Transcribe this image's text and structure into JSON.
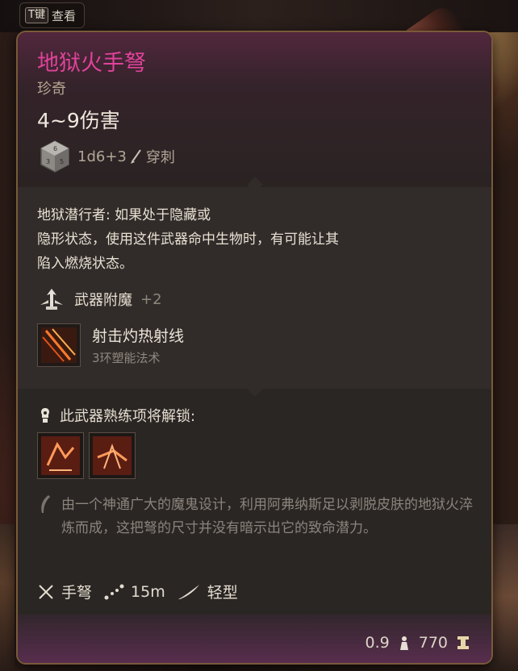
{
  "hint": {
    "key": "T键",
    "label": "查看"
  },
  "item": {
    "name": "地狱火手弩",
    "rarity": "珍奇",
    "damage": "4~9伤害",
    "dice": "1d6+3",
    "damage_type": "穿刺"
  },
  "passive": {
    "title": "地狱潜行者:",
    "line1_rest": " 如果处于隐藏或",
    "line2": "隐形状态，使用这件武器命中生物时，有可能让其",
    "line3": "陷入燃烧状态。"
  },
  "enchant": {
    "label": "武器附魔",
    "value": "+2"
  },
  "spell": {
    "name": "射击灼热射线",
    "level": "3环塑能法术"
  },
  "proficiency": {
    "label": "此武器熟练项将解锁:"
  },
  "lore": "由一个神通广大的魔鬼设计，利用阿弗纳斯足以剥脱皮肤的地狱火淬炼而成，这把弩的尺寸并没有暗示出它的致命潜力。",
  "properties": {
    "type": "手弩",
    "range": "15m",
    "weight_class": "轻型"
  },
  "footer": {
    "weight": "0.9",
    "value": "770"
  },
  "colors": {
    "name": "#e0429a",
    "panel_border": "#7a5a3a",
    "enchant_plus": "#8e867c"
  }
}
